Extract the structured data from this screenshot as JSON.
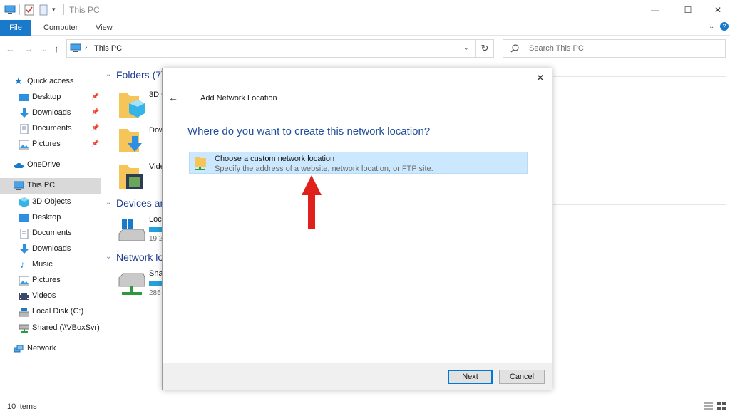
{
  "window": {
    "title": "This PC",
    "controls": {
      "minimize": "—",
      "maximize": "☐",
      "close": "✕"
    }
  },
  "ribbon": {
    "tabs": [
      "File",
      "Computer",
      "View"
    ]
  },
  "address": {
    "path": "This PC",
    "separator": "›"
  },
  "search": {
    "placeholder": "Search This PC"
  },
  "nav_pane": {
    "items": [
      {
        "label": "Quick access",
        "icon": "star-icon"
      },
      {
        "label": "Desktop",
        "icon": "desktop-icon",
        "pinned": true
      },
      {
        "label": "Downloads",
        "icon": "download-icon",
        "pinned": true
      },
      {
        "label": "Documents",
        "icon": "documents-icon",
        "pinned": true
      },
      {
        "label": "Pictures",
        "icon": "pictures-icon",
        "pinned": true
      },
      {
        "label": "OneDrive",
        "icon": "cloud-icon"
      },
      {
        "label": "This PC",
        "icon": "pc-icon",
        "selected": true
      },
      {
        "label": "3D Objects",
        "icon": "cube-icon"
      },
      {
        "label": "Desktop",
        "icon": "desktop-icon"
      },
      {
        "label": "Documents",
        "icon": "documents-icon"
      },
      {
        "label": "Downloads",
        "icon": "download-icon"
      },
      {
        "label": "Music",
        "icon": "music-icon"
      },
      {
        "label": "Pictures",
        "icon": "pictures-icon"
      },
      {
        "label": "Videos",
        "icon": "videos-icon"
      },
      {
        "label": "Local Disk (C:)",
        "icon": "drive-icon"
      },
      {
        "label": "Shared (\\\\VBoxSvr)",
        "icon": "network-drive-icon"
      },
      {
        "label": "Network",
        "icon": "network-icon"
      }
    ]
  },
  "content": {
    "groups": [
      {
        "label": "Folders (7)"
      },
      {
        "label": "Devices an"
      },
      {
        "label": "Network lo"
      }
    ],
    "items": [
      {
        "label": "3D O"
      },
      {
        "label": "Dow"
      },
      {
        "label": "Vide"
      },
      {
        "label": "Loc",
        "size": "19.2"
      },
      {
        "label": "Sha",
        "size": "285"
      }
    ]
  },
  "status": {
    "count": "10 items"
  },
  "dialog": {
    "title": "Add Network Location",
    "heading": "Where do you want to create this network location?",
    "option": {
      "title": "Choose a custom network location",
      "description": "Specify the address of a website, network location, or FTP site."
    },
    "buttons": {
      "next": "Next",
      "cancel": "Cancel"
    },
    "close": "✕",
    "back": "←"
  },
  "colors": {
    "accent": "#1979ca",
    "heading": "#1f4e9c",
    "selection": "#cce8ff",
    "arrow": "#e0201b",
    "progress": "#26a0da"
  }
}
